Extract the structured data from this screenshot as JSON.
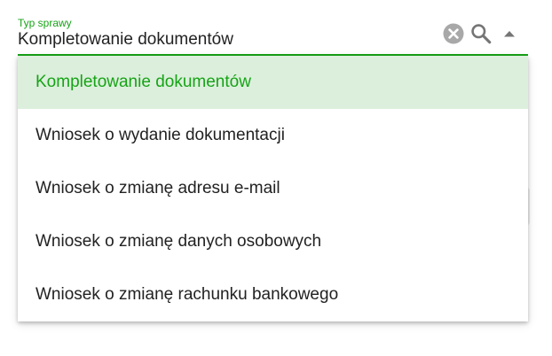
{
  "colors": {
    "accent": "#17a317",
    "selected_background": "#dcefdc",
    "text": "#222222",
    "icon": "#757575",
    "clear_icon": "#a8a8a8"
  },
  "field": {
    "label": "Typ sprawy",
    "value": "Kompletowanie dokumentów",
    "icons": {
      "clear": "close-circle-icon",
      "search": "search-icon",
      "toggle": "arrow-up-icon"
    }
  },
  "menu": {
    "selected_index": 0,
    "items": [
      {
        "label": "Kompletowanie dokumentów"
      },
      {
        "label": "Wniosek o wydanie dokumentacji"
      },
      {
        "label": "Wniosek o zmianę adresu e-mail"
      },
      {
        "label": "Wniosek o zmianę danych osobowych"
      },
      {
        "label": "Wniosek o zmianę rachunku bankowego"
      }
    ]
  }
}
